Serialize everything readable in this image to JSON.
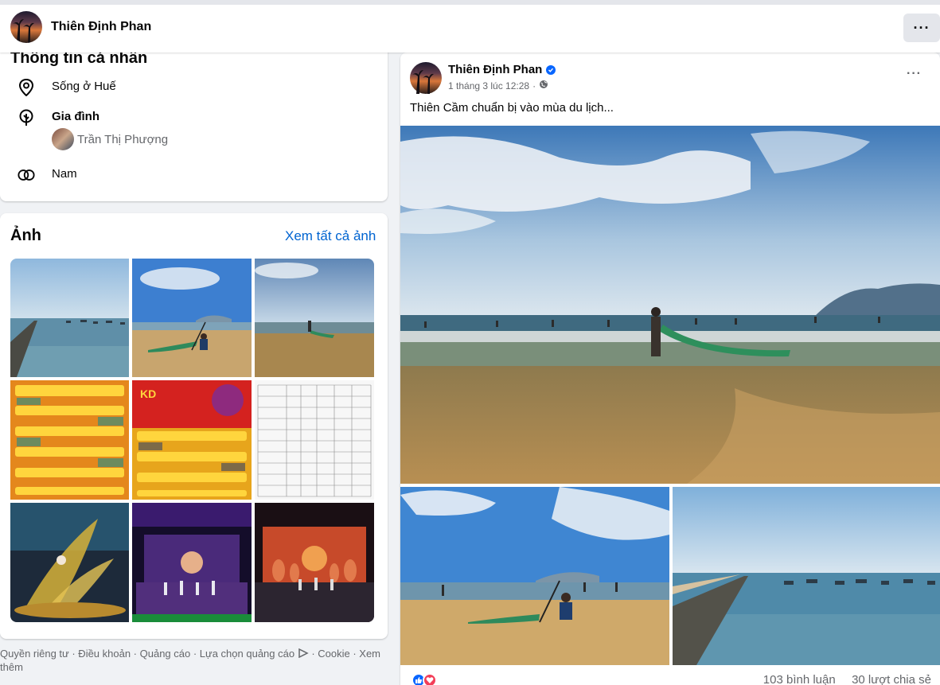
{
  "header": {
    "name": "Thiên Định Phan",
    "more_label": "···"
  },
  "intro": {
    "title": "Thông tin cá nhân",
    "lives_in": "Sống ở Huế",
    "family_label": "Gia đình",
    "family_member": "Trần Thị Phượng",
    "gender": "Nam"
  },
  "photos": {
    "title": "Ảnh",
    "see_all": "Xem tất cả ảnh"
  },
  "footer": {
    "text": "Quyền riêng tư · Điều khoản · Quảng cáo · Lựa chọn quảng cáo",
    "text2": " · Cookie · Xem thêm"
  },
  "post": {
    "author": "Thiên Định Phan",
    "time": "1 tháng 3 lúc 12:28",
    "separator": "·",
    "text": "Thiên Cầm chuẩn bị vào mùa du lịch...",
    "comments": "103 bình luận",
    "shares": "30 lượt chia sẻ",
    "more_label": "···"
  },
  "colors": {
    "link": "#0064d1",
    "like": "#0866ff",
    "love": "#f33e58"
  }
}
